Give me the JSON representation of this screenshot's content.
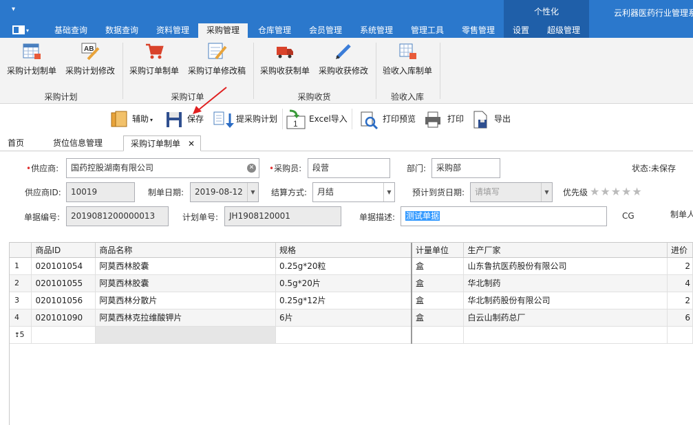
{
  "titlebar": {
    "quick_access": "▾",
    "personalize": "个性化",
    "app_title": "云利器医药行业管理系"
  },
  "menu_tabs": [
    "基础查询",
    "数据查询",
    "资料管理",
    "采购管理",
    "仓库管理",
    "会员管理",
    "系统管理",
    "管理工具",
    "零售管理",
    "设置",
    "超级管理"
  ],
  "ribbon": {
    "buttons": [
      "采购计划制单",
      "采购计划修改",
      "采购订单制单",
      "采购订单修改稿",
      "采购收获制单",
      "采购收获修改",
      "验收入库制单"
    ],
    "groups": [
      "采购计划",
      "采购订单",
      "采购收货",
      "验收入库"
    ]
  },
  "toolbar": {
    "assist": "辅助",
    "save": "保存",
    "pull_plan": "提采购计划",
    "excel_import": "Excel导入",
    "print_preview": "打印预览",
    "print": "打印",
    "export": "导出"
  },
  "doc_tabs": [
    "首页",
    "货位信息管理",
    "采购订单制单"
  ],
  "form": {
    "supplier_label": "供应商:",
    "supplier_value": "国药控股湖南有限公司",
    "buyer_label": "采购员:",
    "buyer_value": "段营",
    "dept_label": "部门:",
    "dept_value": "采购部",
    "status_label": "状态:",
    "status_value": "未保存",
    "supplier_id_label": "供应商ID:",
    "supplier_id_value": "10019",
    "date_label": "制单日期:",
    "date_value": "2019-08-12",
    "settle_label": "结算方式:",
    "settle_value": "月结",
    "arrival_label": "预计到货日期:",
    "arrival_placeholder": "请填写",
    "priority_label": "优先级",
    "priority_stars": "★★★★★",
    "docno_label": "单据编号:",
    "docno_value": "2019081200000013",
    "planno_label": "计划单号:",
    "planno_value": "JH1908120001",
    "desc_label": "单据描述:",
    "desc_value": "测试单据",
    "cg_text": "CG",
    "maker_label": "制单人"
  },
  "grid": {
    "columns": [
      "商品ID",
      "商品名称",
      "规格",
      "计量单位",
      "生产厂家",
      "进价"
    ],
    "rows": [
      {
        "n": "1",
        "id": "020101054",
        "name": "阿莫西林胶囊",
        "spec": "0.25g*20粒",
        "unit": "盒",
        "maker": "山东鲁抗医药股份有限公司",
        "price": "2"
      },
      {
        "n": "2",
        "id": "020101055",
        "name": "阿莫西林胶囊",
        "spec": "0.5g*20片",
        "unit": "盒",
        "maker": "华北制药",
        "price": "4"
      },
      {
        "n": "3",
        "id": "020101056",
        "name": "阿莫西林分散片",
        "spec": "0.25g*12片",
        "unit": "盒",
        "maker": "华北制药股份有限公司",
        "price": "2"
      },
      {
        "n": "4",
        "id": "020101090",
        "name": "阿莫西林克拉维酸钾片",
        "spec": "6片",
        "unit": "盒",
        "maker": "白云山制药总厂",
        "price": "6"
      }
    ],
    "new_row_label": "5"
  }
}
